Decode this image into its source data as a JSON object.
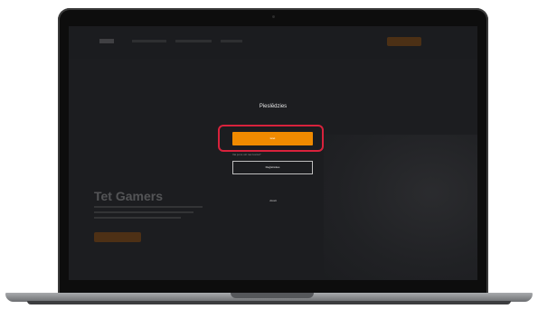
{
  "login": {
    "title": "Pieslēdzies",
    "primary_button_label": "Ieiet",
    "hint_text": "Vai jums vēl nav konta?",
    "secondary_button_label": "Reģistrēties",
    "footer_link": "Atcelt"
  },
  "background_site": {
    "hero_title": "Tet Gamers"
  },
  "colors": {
    "accent": "#f08a00",
    "highlight": "#d8223c",
    "screen_bg": "#1c1d20"
  },
  "icons": [
    "camera-icon"
  ]
}
